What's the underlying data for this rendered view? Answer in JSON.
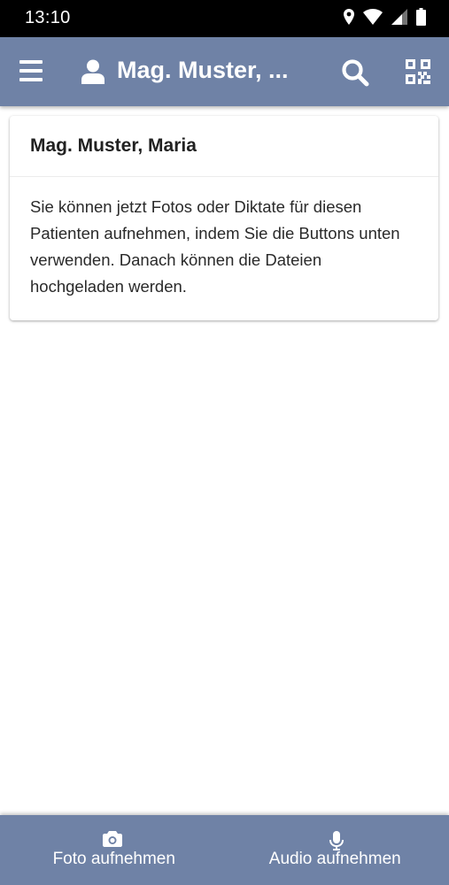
{
  "status_bar": {
    "time": "13:10",
    "icons": [
      "location-icon",
      "wifi-icon",
      "signal-icon",
      "battery-icon"
    ]
  },
  "app_bar": {
    "title": "Mag. Muster, ...",
    "icons": [
      "menu-icon",
      "user-icon",
      "search-icon",
      "qr-code-icon"
    ],
    "color": "#6f82a6"
  },
  "patient_card": {
    "name": "Mag. Muster, Maria",
    "message": "Sie können jetzt Fotos oder Diktate für diesen Patienten aufnehmen, indem Sie die Buttons unten verwenden. Danach können die Dateien hochgeladen werden."
  },
  "bottom_bar": {
    "photo_button": {
      "label": "Foto aufnehmen",
      "icon": "camera-icon"
    },
    "audio_button": {
      "label": "Audio aufnehmen",
      "icon": "microphone-icon"
    },
    "color": "#6f82a6"
  }
}
